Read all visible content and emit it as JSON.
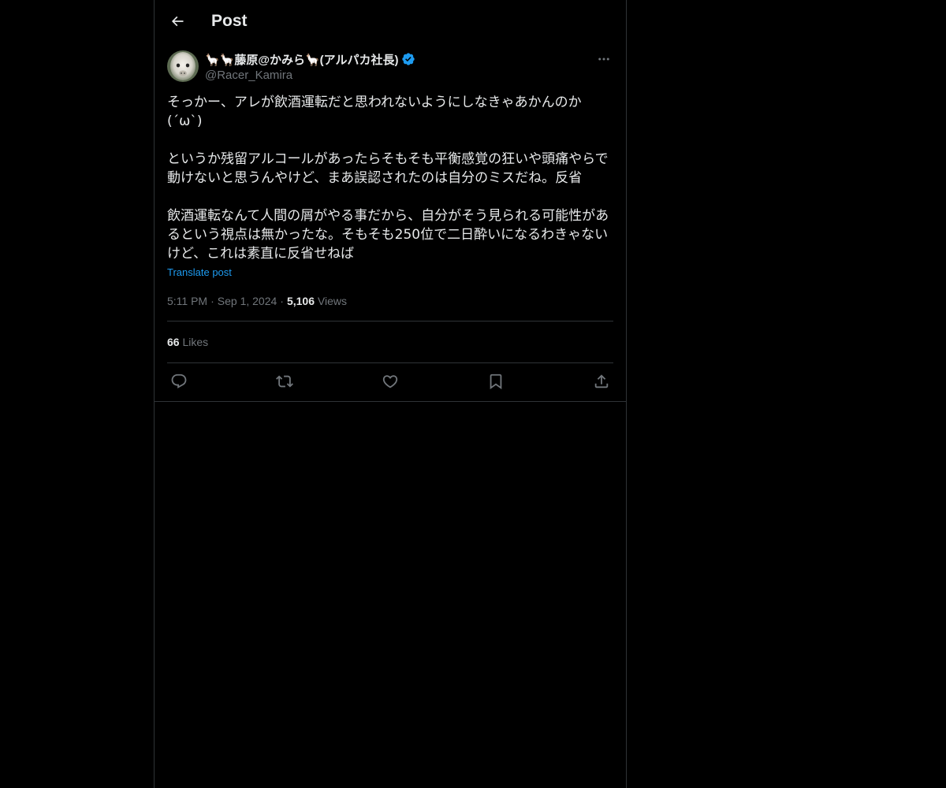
{
  "header": {
    "title": "Post",
    "back_icon": "arrow-left-icon"
  },
  "author": {
    "display_name": "🦙🦙藤原@かみら🦙(アルパカ社長)",
    "handle": "@Racer_Kamira",
    "verified": true,
    "verified_color": "#1d9bf0"
  },
  "post": {
    "text": "そっかー、アレが飲酒運転だと思われないようにしなきゃあかんのか(´ω`)\n\nというか残留アルコールがあったらそもそも平衡感覚の狂いや頭痛やらで動けないと思うんやけど、まあ誤認されたのは自分のミスだね。反省\n\n飲酒運転なんて人間の屑がやる事だから、自分がそう見られる可能性があるという視点は無かったな。そもそも250位で二日酔いになるわきゃないけど、これは素直に反省せねば",
    "translate_label": "Translate post",
    "time": "5:11 PM",
    "date": "Sep 1, 2024",
    "views_count": "5,106",
    "views_label": "Views",
    "likes_count": "66",
    "likes_label": "Likes"
  },
  "actions": [
    {
      "icon": "reply-icon"
    },
    {
      "icon": "repost-icon"
    },
    {
      "icon": "like-icon"
    },
    {
      "icon": "bookmark-icon"
    },
    {
      "icon": "share-icon"
    }
  ],
  "colors": {
    "background": "#000000",
    "text": "#e7e9ea",
    "secondary": "#71767b",
    "accent": "#1d9bf0",
    "border": "#2f3336"
  }
}
